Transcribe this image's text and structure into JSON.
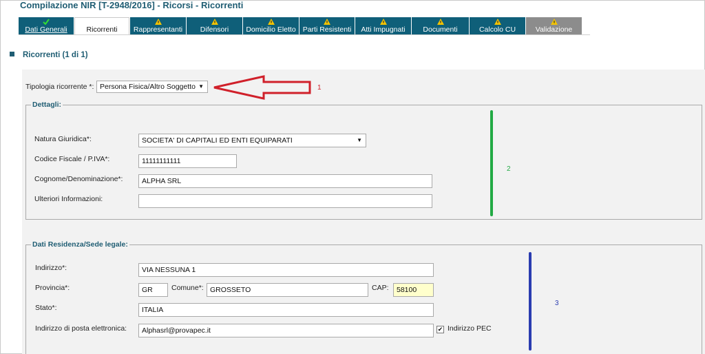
{
  "window_title": "Compilazione NIR [T-2948/2016] - Ricorsi - Ricorrenti",
  "tabs": [
    {
      "label": "Dati Generali",
      "icon": "check-icon",
      "state": "done"
    },
    {
      "label": "Ricorrenti",
      "icon": "",
      "state": "active"
    },
    {
      "label": "Rappresentanti",
      "icon": "warning-icon",
      "state": "normal"
    },
    {
      "label": "Difensori",
      "icon": "warning-icon",
      "state": "normal"
    },
    {
      "label": "Domicilio Eletto",
      "icon": "warning-icon",
      "state": "normal"
    },
    {
      "label": "Parti Resistenti",
      "icon": "warning-icon",
      "state": "normal"
    },
    {
      "label": "Atti Impugnati",
      "icon": "warning-icon",
      "state": "normal"
    },
    {
      "label": "Documenti",
      "icon": "warning-icon",
      "state": "normal"
    },
    {
      "label": "Calcolo CU",
      "icon": "warning-icon",
      "state": "normal"
    },
    {
      "label": "Validazione",
      "icon": "warning-icon",
      "state": "disabled"
    }
  ],
  "section_title": "Ricorrenti (1 di 1)",
  "tipologia": {
    "label": "Tipologia ricorrente *:",
    "value": "Persona Fisica/Altro Soggetto"
  },
  "dettagli": {
    "legend": "Dettagli:",
    "natura_label": "Natura Giuridica*:",
    "natura_value": "SOCIETA' DI CAPITALI ED ENTI EQUIPARATI",
    "cf_label": "Codice Fiscale / P.IVA*:",
    "cf_value": "11111111111",
    "cognome_label": "Cognome/Denominazione*:",
    "cognome_value": "ALPHA SRL",
    "ulteriori_label": "Ulteriori Informazioni:",
    "ulteriori_value": ""
  },
  "residenza": {
    "legend": "Dati Residenza/Sede legale:",
    "indirizzo_label": "Indirizzo*:",
    "indirizzo_value": "VIA NESSUNA 1",
    "provincia_label": "Provincia*:",
    "provincia_value": "GR",
    "comune_label": "Comune*:",
    "comune_value": "GROSSETO",
    "cap_label": "CAP:",
    "cap_value": "58100",
    "stato_label": "Stato*:",
    "stato_value": "ITALIA",
    "pec_label": "Indirizzo di posta elettronica:",
    "pec_value": "Alphasrl@provapec.it",
    "pec_checkbox_label": "Indirizzo PEC",
    "pec_checked": true
  },
  "annotations": {
    "one": "1",
    "two": "2",
    "three": "3"
  },
  "colors": {
    "tab_bg": "#0f5f79",
    "title": "#1f5d73",
    "arrow": "#d0202a",
    "green_bar": "#22aa44",
    "blue_bar": "#2a3cb0"
  }
}
